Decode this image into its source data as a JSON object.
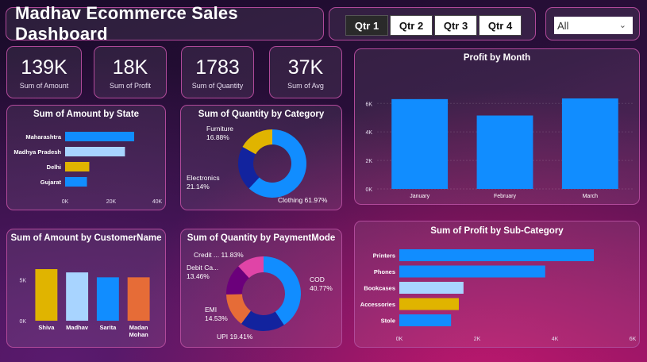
{
  "header": {
    "title": "Madhav Ecommerce Sales Dashboard",
    "quarters": [
      "Qtr 1",
      "Qtr 2",
      "Qtr 3",
      "Qtr 4"
    ],
    "active_quarter": "Qtr 1",
    "filter_value": "All"
  },
  "kpis": [
    {
      "value": "139K",
      "label": "Sum of Amount"
    },
    {
      "value": "18K",
      "label": "Sum of Profit"
    },
    {
      "value": "1783",
      "label": "Sum of Quantity"
    },
    {
      "value": "37K",
      "label": "Sum of Avg"
    }
  ],
  "colors": {
    "blue": "#118dff",
    "light_blue": "#a8d4ff",
    "gold": "#e0b400",
    "orange": "#e66c37",
    "navy": "#12239e",
    "purple": "#6b007b",
    "pink": "#e044a7",
    "panel_border": "#b04a9a"
  },
  "chart_data": [
    {
      "id": "state",
      "type": "bar",
      "orientation": "horizontal",
      "title": "Sum of Amount by State",
      "categories": [
        "Maharashtra",
        "Madhya Pradesh",
        "Delhi",
        "Gujarat"
      ],
      "values": [
        30000,
        26000,
        10500,
        9500
      ],
      "colors": [
        "blue",
        "light_blue",
        "gold",
        "blue"
      ],
      "xlim": [
        0,
        40000
      ],
      "xticks": [
        "0K",
        "20K",
        "40K"
      ]
    },
    {
      "id": "category",
      "type": "pie",
      "donut": true,
      "title": "Sum of Quantity by Category",
      "slices": [
        {
          "label": "Clothing",
          "pct": "61.97%",
          "value": 61.97,
          "color": "blue"
        },
        {
          "label": "Electronics",
          "pct": "21.14%",
          "value": 21.14,
          "color": "navy"
        },
        {
          "label": "Furniture",
          "pct": "16.88%",
          "value": 16.88,
          "color": "gold"
        }
      ]
    },
    {
      "id": "month",
      "type": "bar",
      "title": "Profit by Month",
      "categories": [
        "January",
        "February",
        "March"
      ],
      "values": [
        6300,
        5150,
        6350
      ],
      "colors": [
        "blue",
        "blue",
        "blue"
      ],
      "ylim": [
        0,
        7000
      ],
      "yticks": [
        "0K",
        "2K",
        "4K",
        "6K"
      ]
    },
    {
      "id": "customer",
      "type": "bar",
      "title": "Sum of Amount by CustomerName",
      "categories": [
        "Shiva",
        "Madhav",
        "Sarita",
        "Madan Mohan"
      ],
      "values": [
        6300,
        5900,
        5300,
        5300
      ],
      "colors": [
        "gold",
        "light_blue",
        "blue",
        "orange"
      ],
      "ylim": [
        0,
        7000
      ],
      "yticks": [
        "0K",
        "5K"
      ]
    },
    {
      "id": "payment",
      "type": "pie",
      "donut": true,
      "title": "Sum of Quantity by PaymentMode",
      "slices": [
        {
          "label": "COD",
          "pct": "40.77%",
          "value": 40.77,
          "color": "blue"
        },
        {
          "label": "UPI",
          "pct": "19.41%",
          "value": 19.41,
          "color": "navy"
        },
        {
          "label": "EMI",
          "pct": "14.53%",
          "value": 14.53,
          "color": "orange"
        },
        {
          "label": "Debit Ca...",
          "pct": "13.46%",
          "value": 13.46,
          "color": "purple"
        },
        {
          "label": "Credit ...",
          "pct": "11.83%",
          "value": 11.83,
          "color": "pink"
        }
      ]
    },
    {
      "id": "subcategory",
      "type": "bar",
      "orientation": "horizontal",
      "title": "Sum of Profit by Sub-Category",
      "categories": [
        "Printers",
        "Phones",
        "Bookcases",
        "Accessories",
        "Stole"
      ],
      "values": [
        5000,
        3750,
        1650,
        1530,
        1330
      ],
      "colors": [
        "blue",
        "blue",
        "light_blue",
        "gold",
        "blue"
      ],
      "xlim": [
        0,
        6000
      ],
      "xticks": [
        "0K",
        "2K",
        "4K",
        "6K"
      ]
    }
  ]
}
